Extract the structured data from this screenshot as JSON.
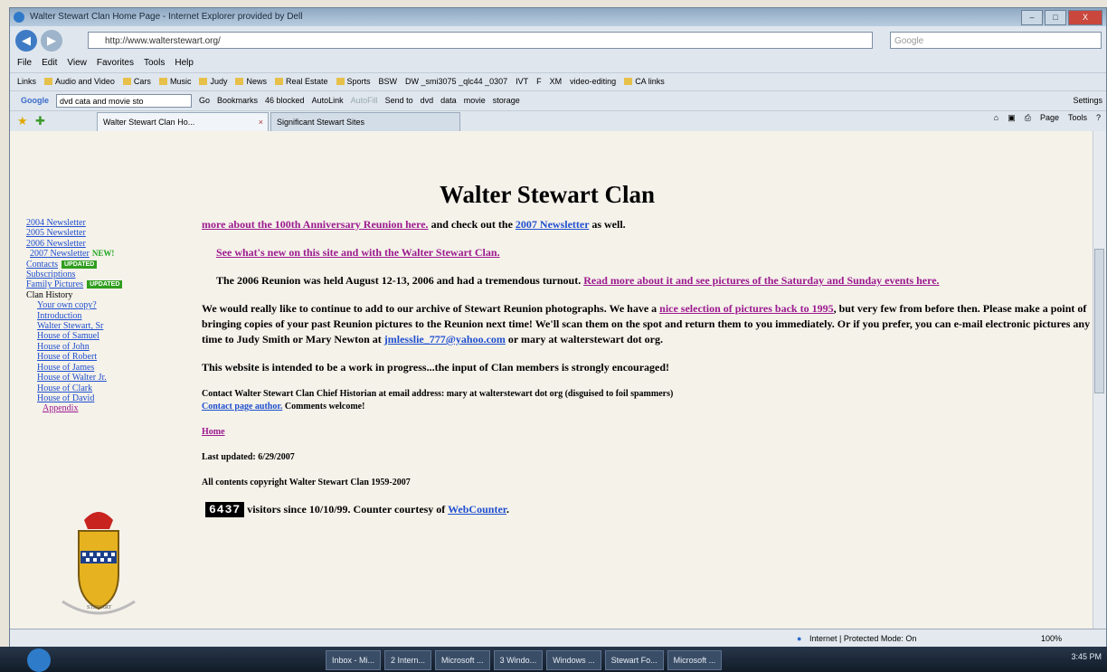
{
  "window": {
    "title": "Walter Stewart Clan Home Page - Internet Explorer provided by Dell",
    "minimize": "–",
    "maximize": "□",
    "close": "X"
  },
  "address": {
    "url": "http://www.walterstewart.org/",
    "search_placeholder": "Google"
  },
  "menu": [
    "File",
    "Edit",
    "View",
    "Favorites",
    "Tools",
    "Help"
  ],
  "links_bar": [
    "Links",
    "Audio and Video",
    "Cars",
    "Music",
    "Judy",
    "News",
    "Real Estate",
    "Sports",
    "BSW",
    "DW _smi3075 _qlc44 _0307",
    "IVT",
    "F",
    "XM",
    "video-editing",
    "CA links"
  ],
  "google_bar": {
    "label": "Google",
    "query": "dvd cata and movie sto",
    "go": "Go",
    "bookmarks": "Bookmarks",
    "blocked": "46 blocked",
    "autolink": "AutoLink",
    "autofill": "AutoFill",
    "sendto": "Send to",
    "chips": [
      "dvd",
      "data",
      "movie",
      "storage"
    ],
    "settings": "Settings"
  },
  "tabs": [
    {
      "label": "Walter Stewart Clan Ho..."
    },
    {
      "label": "Significant Stewart Sites"
    }
  ],
  "command_bar": {
    "page": "Page",
    "tools": "Tools"
  },
  "page": {
    "title": "Walter Stewart Clan",
    "nav": {
      "newsletters": [
        "2004 Newsletter",
        "2005 Newsletter",
        "2006 Newsletter",
        "2007 Newsletter"
      ],
      "new_tag": "NEW!",
      "contacts": "Contacts",
      "updated_badge": "UPDATED",
      "subscriptions": "Subscriptions",
      "family_pictures": "Family Pictures",
      "clan_history": "Clan History",
      "history_items": [
        "Your own copy?",
        "Introduction",
        "Walter Stewart, Sr",
        "House of Samuel",
        "House of John",
        "House of Robert",
        "House of James",
        "House of Walter Jr.",
        "House of Clark",
        "House of David"
      ],
      "appendix": "Appendix",
      "shield_caption": "STEWART"
    },
    "p1": {
      "link": "more about the 100th Anniversary Reunion here.",
      "text": " and check out the ",
      "link2": "2007 Newsletter",
      "text2": " as well."
    },
    "p2_link": "See what's new on this site and with the Walter Stewart Clan.",
    "p3": {
      "text": "The 2006 Reunion was held August 12-13, 2006 and had a tremendous turnout. ",
      "link": "Read more about it and see pictures of the Saturday and Sunday events here."
    },
    "p4": {
      "text1": "We would really like to continue to add to our archive of Stewart Reunion photographs.  We have a ",
      "link": "nice selection of pictures back to 1995",
      "text2": ", but very few from before then.  Please make a point of bringing copies of your past Reunion pictures to the Reunion next time!  We'll scan them on the spot and return them to you immediately.  Or if you prefer, you can e-mail electronic pictures any time to Judy Smith or Mary Newton at ",
      "email": "jmlesslie_777@yahoo.com",
      "text3": " or mary at walterstewart dot org."
    },
    "p5": "This website is intended to be a work in progress...the input of Clan members is strongly encouraged!",
    "contact_line": "Contact Walter Stewart Clan Chief Historian at email address:  mary at walterstewart dot org (disguised to foil spammers)",
    "contact_link": "Contact page author.",
    "comments": "  Comments welcome!",
    "home_link": "Home",
    "last_updated": "Last updated: 6/29/2007",
    "copyright": "All contents copyright Walter Stewart Clan 1959-2007",
    "counter_value": "6437",
    "counter_text": " visitors since 10/10/99. Counter courtesy of ",
    "counter_link": "WebCounter",
    "counter_end": "."
  },
  "status": {
    "zone": "Internet | Protected Mode: On",
    "zoom": "100%"
  },
  "taskbar": {
    "items": [
      "Inbox - Mi...",
      "2 Intern...",
      "Microsoft ...",
      "3 Windo...",
      "Windows ...",
      "Stewart Fo...",
      "Microsoft ..."
    ],
    "clock": "3:45 PM"
  }
}
